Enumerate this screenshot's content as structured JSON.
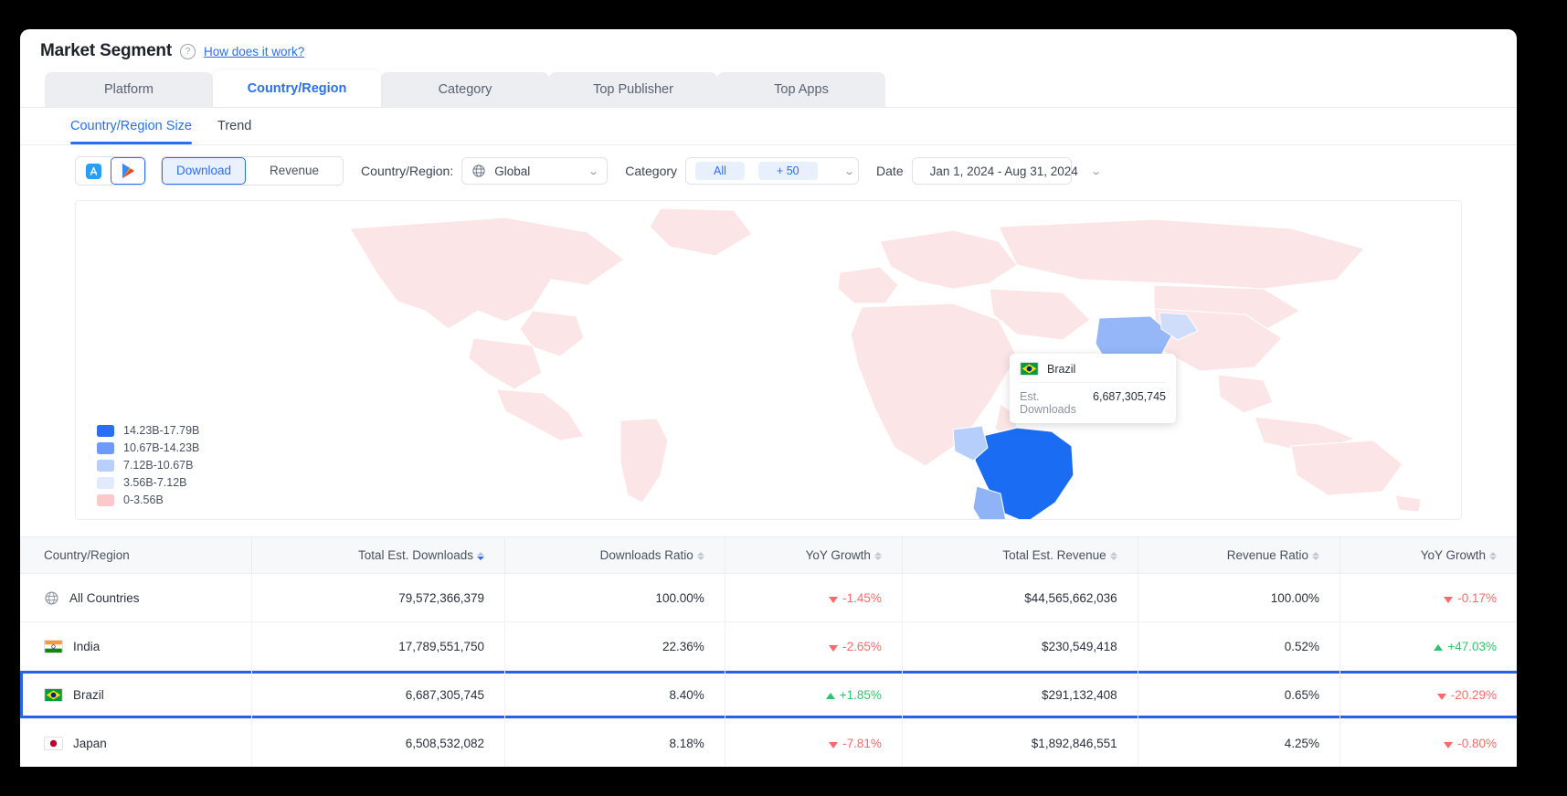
{
  "header": {
    "title": "Market Segment",
    "help_icon": "question-icon",
    "help_link": "How does it work?"
  },
  "tabs": [
    {
      "label": "Platform",
      "active": false
    },
    {
      "label": "Country/Region",
      "active": true
    },
    {
      "label": "Category",
      "active": false
    },
    {
      "label": "Top Publisher",
      "active": false
    },
    {
      "label": "Top Apps",
      "active": false
    }
  ],
  "subtabs": [
    {
      "label": "Country/Region Size",
      "active": true
    },
    {
      "label": "Trend",
      "active": false
    }
  ],
  "toolbar": {
    "store_buttons": [
      {
        "name": "app-store",
        "selected": false
      },
      {
        "name": "google-play",
        "selected": true
      }
    ],
    "metric_buttons": [
      {
        "label": "Download",
        "selected": true
      },
      {
        "label": "Revenue",
        "selected": false
      }
    ],
    "country_label": "Country/Region:",
    "country_value": "Global",
    "country_icon": "globe-icon",
    "category_label": "Category",
    "category_pills": [
      "All",
      "+ 50"
    ],
    "date_label": "Date",
    "date_icon": "calendar-icon",
    "date_value": "Jan 1, 2024 - Aug 31, 2024"
  },
  "map": {
    "legend": [
      {
        "range": "14.23B-17.79B",
        "color": "#2a6ef5"
      },
      {
        "range": "10.67B-14.23B",
        "color": "#6d9bf8"
      },
      {
        "range": "7.12B-10.67B",
        "color": "#b9cffb"
      },
      {
        "range": "3.56B-7.12B",
        "color": "#e2ebfd"
      },
      {
        "range": "0-3.56B",
        "color": "#fbc9cb"
      }
    ],
    "tooltip": {
      "country": "Brazil",
      "flag": "brazil-flag",
      "metric_label": "Est. Downloads",
      "metric_value": "6,687,305,745"
    }
  },
  "table": {
    "columns": [
      {
        "label": "Country/Region",
        "sortable": false,
        "sort": "none"
      },
      {
        "label": "Total Est. Downloads",
        "sortable": true,
        "sort": "desc"
      },
      {
        "label": "Downloads Ratio",
        "sortable": true,
        "sort": "none"
      },
      {
        "label": "YoY Growth",
        "sortable": true,
        "sort": "none"
      },
      {
        "label": "Total Est. Revenue",
        "sortable": true,
        "sort": "none"
      },
      {
        "label": "Revenue Ratio",
        "sortable": true,
        "sort": "none"
      },
      {
        "label": "YoY Growth",
        "sortable": true,
        "sort": "none"
      }
    ],
    "rows": [
      {
        "flag": "globe-icon",
        "country": "All Countries",
        "downloads": "79,572,366,379",
        "downloads_ratio": "100.00%",
        "downloads_yoy": "-1.45%",
        "downloads_yoy_dir": "down",
        "revenue": "$44,565,662,036",
        "revenue_ratio": "100.00%",
        "revenue_yoy": "-0.17%",
        "revenue_yoy_dir": "down",
        "selected": false
      },
      {
        "flag": "india-flag",
        "country": "India",
        "downloads": "17,789,551,750",
        "downloads_ratio": "22.36%",
        "downloads_yoy": "-2.65%",
        "downloads_yoy_dir": "down",
        "revenue": "$230,549,418",
        "revenue_ratio": "0.52%",
        "revenue_yoy": "+47.03%",
        "revenue_yoy_dir": "up",
        "selected": false
      },
      {
        "flag": "brazil-flag",
        "country": "Brazil",
        "downloads": "6,687,305,745",
        "downloads_ratio": "8.40%",
        "downloads_yoy": "+1.85%",
        "downloads_yoy_dir": "up",
        "revenue": "$291,132,408",
        "revenue_ratio": "0.65%",
        "revenue_yoy": "-20.29%",
        "revenue_yoy_dir": "down",
        "selected": true
      },
      {
        "flag": "japan-flag",
        "country": "Japan",
        "downloads": "6,508,532,082",
        "downloads_ratio": "8.18%",
        "downloads_yoy": "-7.81%",
        "downloads_yoy_dir": "down",
        "revenue": "$1,892,846,551",
        "revenue_ratio": "4.25%",
        "revenue_yoy": "-0.80%",
        "revenue_yoy_dir": "down",
        "selected": false
      }
    ]
  },
  "colors": {
    "accent": "#2a6ef5",
    "positive": "#2fc46a",
    "negative": "#fa6a6a"
  }
}
